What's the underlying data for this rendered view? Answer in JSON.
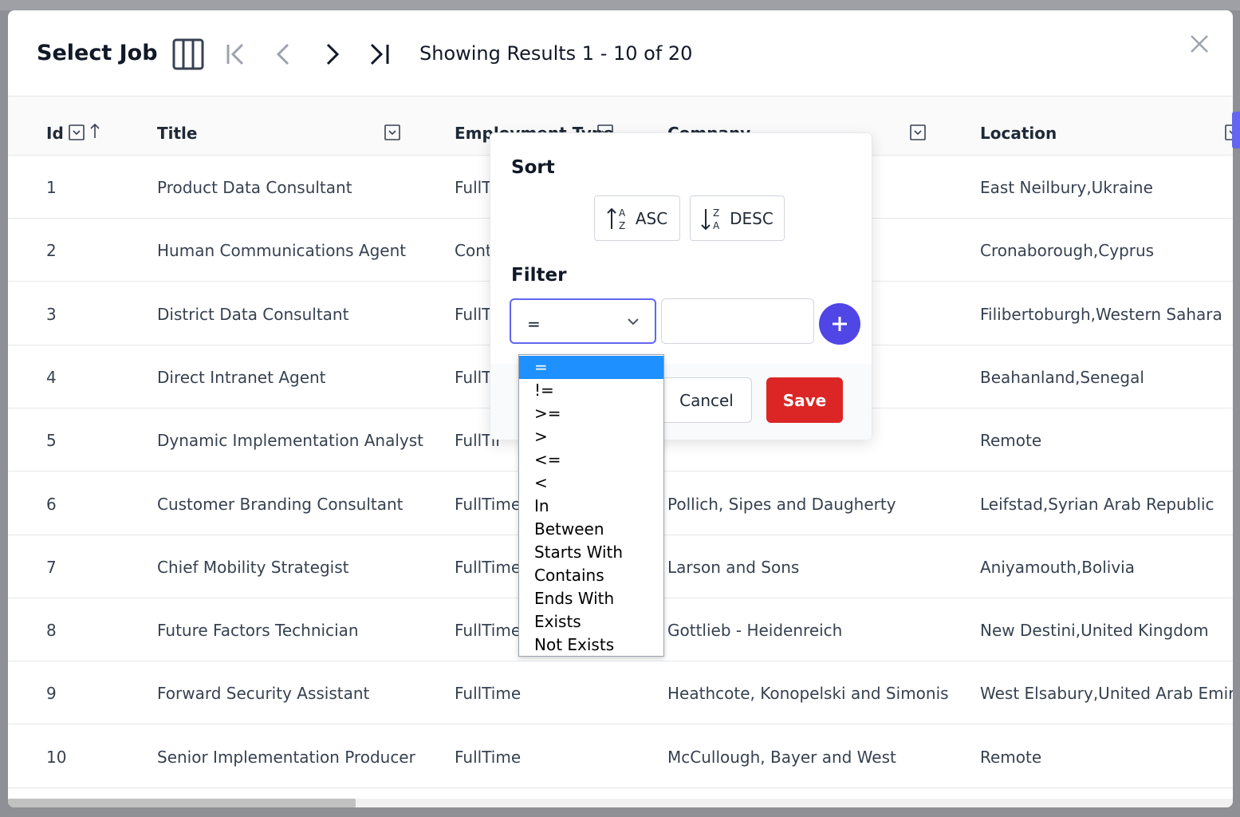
{
  "modal": {
    "title": "Select Job",
    "results_text": "Showing Results 1 - 10 of 20"
  },
  "columns": [
    {
      "key": "id",
      "label": "Id"
    },
    {
      "key": "title",
      "label": "Title"
    },
    {
      "key": "employment_type",
      "label": "Employment Type"
    },
    {
      "key": "company",
      "label": "Company"
    },
    {
      "key": "location",
      "label": "Location"
    }
  ],
  "rows": [
    {
      "id": "1",
      "title": "Product Data Consultant",
      "employment_type": "FullTir",
      "company": "",
      "location": "East Neilbury,Ukraine"
    },
    {
      "id": "2",
      "title": "Human Communications Agent",
      "employment_type": "Contra",
      "company": "",
      "location": "Cronaborough,Cyprus"
    },
    {
      "id": "3",
      "title": "District Data Consultant",
      "employment_type": "FullTir",
      "company": "",
      "location": "Filibertoburgh,Western Sahara"
    },
    {
      "id": "4",
      "title": "Direct Intranet Agent",
      "employment_type": "FullTir",
      "company": "",
      "location": "Beahanland,Senegal"
    },
    {
      "id": "5",
      "title": "Dynamic Implementation Analyst",
      "employment_type": "FullTir",
      "company": "",
      "location": "Remote"
    },
    {
      "id": "6",
      "title": "Customer Branding Consultant",
      "employment_type": "FullTime",
      "company": "Pollich, Sipes and Daugherty",
      "location": "Leifstad,Syrian Arab Republic"
    },
    {
      "id": "7",
      "title": "Chief Mobility Strategist",
      "employment_type": "FullTime",
      "company": "Larson and Sons",
      "location": "Aniyamouth,Bolivia"
    },
    {
      "id": "8",
      "title": "Future Factors Technician",
      "employment_type": "FullTime",
      "company": "Gottlieb - Heidenreich",
      "location": "New Destini,United Kingdom"
    },
    {
      "id": "9",
      "title": "Forward Security Assistant",
      "employment_type": "FullTime",
      "company": "Heathcote, Konopelski and Simonis",
      "location": "West Elsabury,United Arab Emirate"
    },
    {
      "id": "10",
      "title": "Senior Implementation Producer",
      "employment_type": "FullTime",
      "company": "McCullough, Bayer and West",
      "location": "Remote"
    }
  ],
  "popover": {
    "sort_label": "Sort",
    "asc_label": "ASC",
    "desc_label": "DESC",
    "filter_label": "Filter",
    "operator_value": "=",
    "filter_value": "",
    "cancel_label": "Cancel",
    "save_label": "Save"
  },
  "operator_options": [
    "=",
    "!=",
    ">=",
    ">",
    "<=",
    "<",
    "In",
    "Between",
    "Starts With",
    "Contains",
    "Ends With",
    "Exists",
    "Not Exists"
  ],
  "selected_operator_index": 0,
  "colors": {
    "accent": "#4f46e5",
    "save": "#dc2626",
    "selected_option": "#1e90ff"
  },
  "icons": {
    "columns": "columns-icon",
    "first": "first-page-icon",
    "prev": "chevron-left-icon",
    "next": "chevron-right-icon",
    "last": "last-page-icon",
    "close": "close-icon",
    "filter": "filter-dropdown-icon",
    "sort": "sort-up-arrow-icon"
  }
}
